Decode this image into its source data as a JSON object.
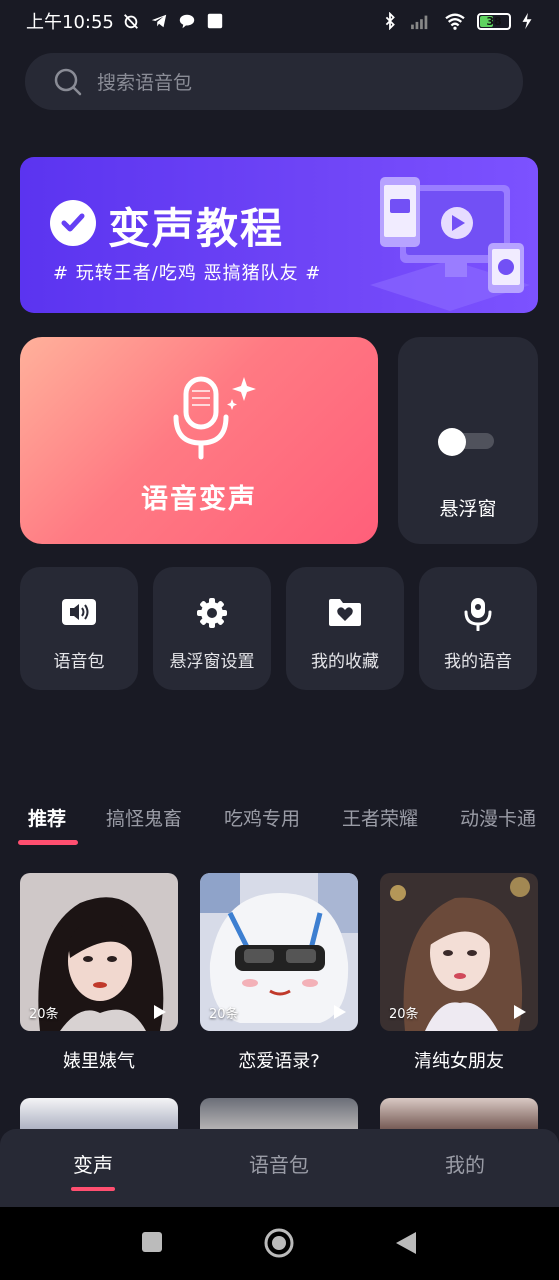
{
  "status_bar": {
    "time": "上午10:55",
    "battery": "38"
  },
  "search": {
    "placeholder": "搜索语音包"
  },
  "banner": {
    "title": "变声教程",
    "subtitle": "# 玩转王者/吃鸡 恶搞猪队友 #"
  },
  "voice_change": {
    "label": "语音变声"
  },
  "floating_window": {
    "label": "悬浮窗",
    "toggle_on": false
  },
  "tools": [
    {
      "label": "语音包",
      "icon": "speaker-icon"
    },
    {
      "label": "悬浮窗设置",
      "icon": "gear-icon"
    },
    {
      "label": "我的收藏",
      "icon": "heart-folder-icon"
    },
    {
      "label": "我的语音",
      "icon": "microphone-icon"
    }
  ],
  "tabs": [
    {
      "label": "推荐",
      "active": true
    },
    {
      "label": "搞怪鬼畜",
      "active": false
    },
    {
      "label": "吃鸡专用",
      "active": false
    },
    {
      "label": "王者荣耀",
      "active": false
    },
    {
      "label": "动漫卡通",
      "active": false
    }
  ],
  "packs": [
    {
      "name": "婊里婊气",
      "count": "20条"
    },
    {
      "name": "恋爱语录?",
      "count": "20条"
    },
    {
      "name": "清纯女朋友",
      "count": "20条"
    }
  ],
  "bottom_nav": [
    {
      "label": "变声",
      "active": true
    },
    {
      "label": "语音包",
      "active": false
    },
    {
      "label": "我的",
      "active": false
    }
  ],
  "colors": {
    "background": "#191a24",
    "card": "#272935",
    "accent": "#ff4f70",
    "banner": "#6e44f6"
  }
}
